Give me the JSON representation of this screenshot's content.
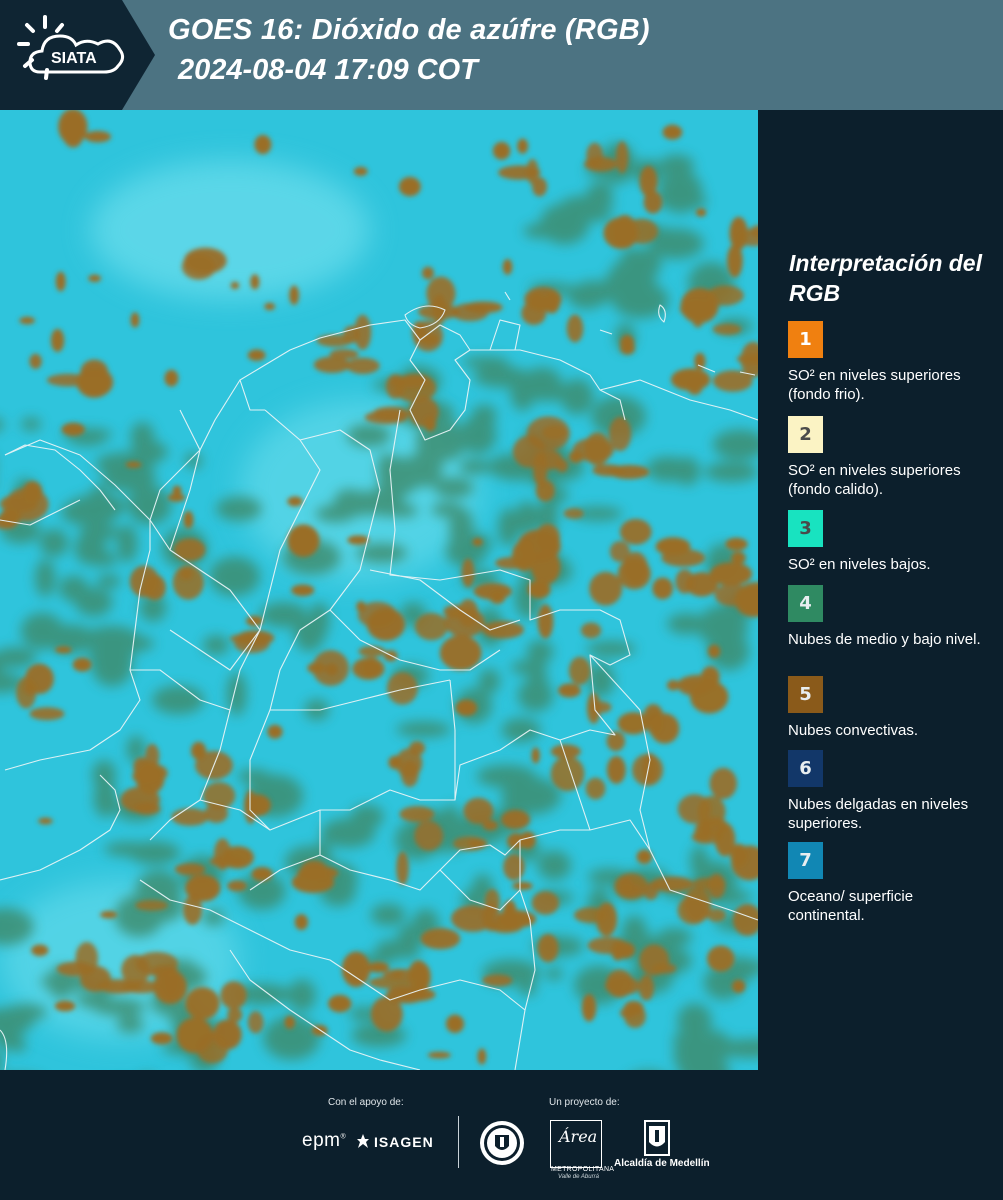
{
  "header": {
    "logo_text": "SIATA",
    "title_line1": "GOES 16: Dióxido de azúfre (RGB)",
    "title_line2": "2024-08-04 17:09 COT",
    "bg_color": "#4c7382",
    "logo_bg_color": "#0f2533"
  },
  "map": {
    "ocean_color": "#2fc4dc",
    "convective_color": "#9a6e27",
    "low_cloud_color": "#3c8a6a",
    "border_color": "#e8f4f6"
  },
  "legend": {
    "title": "Interpretación del RGB",
    "items": [
      {
        "number": "1",
        "color": "#f08010",
        "label": "SO² en niveles superiores (fondo frio)."
      },
      {
        "number": "2",
        "color": "#fbf3c4",
        "label": "SO² en niveles superiores (fondo calido)."
      },
      {
        "number": "3",
        "color": "#18e3c0",
        "label": "SO² en niveles bajos."
      },
      {
        "number": "4",
        "color": "#2f8a62",
        "label": "Nubes de medio y bajo nivel."
      },
      {
        "number": "5",
        "color": "#8a5a1a",
        "label": "Nubes convectivas."
      },
      {
        "number": "6",
        "color": "#123769",
        "label": "Nubes delgadas en niveles superiores."
      },
      {
        "number": "7",
        "color": "#1187b4",
        "label": "Oceano/ superficie continental."
      }
    ]
  },
  "footer": {
    "support_label": "Con el apoyo de:",
    "project_label": "Un proyecto de:",
    "epm": "epm",
    "isagen": "ISAGEN",
    "area_word": "Área",
    "area_sub1": "METROPOLITANA",
    "area_sub2": "Valle de Aburrá",
    "alcaldia": "Alcaldía de Medellín"
  }
}
